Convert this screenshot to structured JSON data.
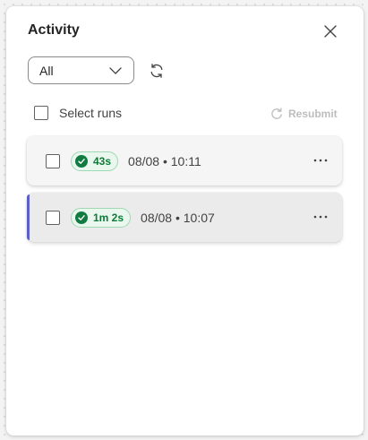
{
  "panel": {
    "title": "Activity"
  },
  "filter": {
    "selected": "All"
  },
  "selection": {
    "select_label": "Select runs",
    "resubmit_label": "Resubmit"
  },
  "runs": [
    {
      "duration": "43s",
      "timestamp": "08/08 • 10:11",
      "status": "succeeded",
      "selected": false
    },
    {
      "duration": "1m 2s",
      "timestamp": "08/08 • 10:07",
      "status": "succeeded",
      "selected": true
    }
  ],
  "colors": {
    "accent": "#5b5fc7",
    "success": "#107c41",
    "success_bg": "#e9f7ee"
  },
  "icons": {
    "close": "close-icon",
    "dropdown": "chevron-down-icon",
    "refresh": "refresh-icon",
    "resubmit": "resubmit-icon",
    "status": "checkmark-circle-icon",
    "more": "more-horizontal-icon"
  }
}
